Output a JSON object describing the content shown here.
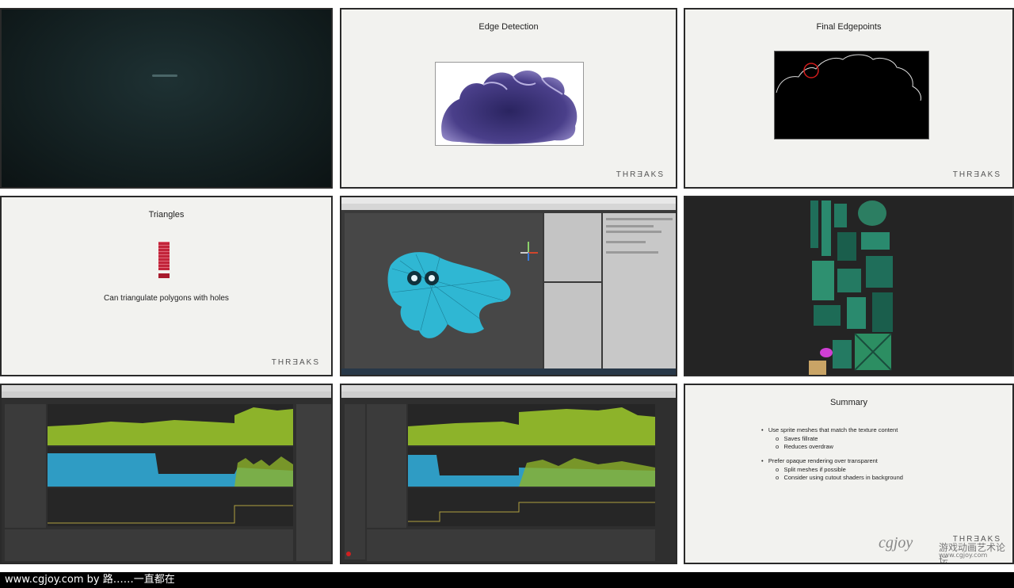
{
  "slides": {
    "edge_detection": {
      "title": "Edge Detection",
      "brand": "THRƎAKS"
    },
    "final_edgepoints": {
      "title": "Final Edgepoints",
      "brand": "THRƎAKS"
    },
    "triangles": {
      "title": "Triangles",
      "caption": "Can triangulate polygons with holes",
      "brand": "THRƎAKS"
    },
    "summary": {
      "title": "Summary",
      "bullets": [
        {
          "text": "Use sprite meshes that match the texture content",
          "sub": [
            "Saves fillrate",
            "Reduces overdraw"
          ]
        },
        {
          "text": "Prefer opaque rendering over transparent",
          "sub": [
            "Split meshes if possible",
            "Consider using cutout shaders in background"
          ]
        }
      ],
      "brand": "THRƎAKS"
    }
  },
  "watermark": {
    "cn_text": "游戏动画艺术论坛",
    "url": "www.cgjoy.com"
  },
  "footer": {
    "text": "www.cgjoy.com by 路……一直都在"
  },
  "colors": {
    "cpu_green": "#8db32a",
    "gpu_blue": "#2f9cc4",
    "editor_dark": "#3d3d3d",
    "ghost_cyan": "#29b9d9"
  }
}
